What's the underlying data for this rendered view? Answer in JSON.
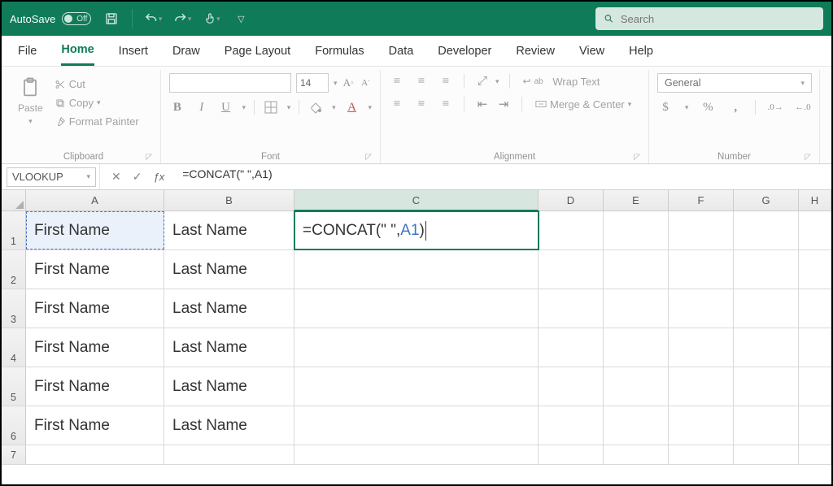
{
  "titlebar": {
    "autosave_label": "AutoSave",
    "autosave_state": "Off"
  },
  "search": {
    "placeholder": "Search"
  },
  "tabs": [
    "File",
    "Home",
    "Insert",
    "Draw",
    "Page Layout",
    "Formulas",
    "Data",
    "Developer",
    "Review",
    "View",
    "Help"
  ],
  "active_tab": "Home",
  "ribbon": {
    "clipboard": {
      "paste": "Paste",
      "cut": "Cut",
      "copy": "Copy",
      "format_painter": "Format Painter",
      "group_label": "Clipboard"
    },
    "font": {
      "size": "14",
      "group_label": "Font"
    },
    "alignment": {
      "wrap": "Wrap Text",
      "merge": "Merge & Center",
      "group_label": "Alignment"
    },
    "number": {
      "format": "General",
      "group_label": "Number"
    }
  },
  "formula_bar": {
    "name_box": "VLOOKUP",
    "formula": "=CONCAT(\"       \",A1)"
  },
  "grid": {
    "columns": [
      "A",
      "B",
      "C",
      "D",
      "E",
      "F",
      "G",
      "H"
    ],
    "selected_col": "C",
    "rows": [
      {
        "n": 1,
        "A": "First Name",
        "B": "Last Name",
        "C_edit": {
          "pre": "=CONCAT(\"       \",",
          "ref": "A1",
          "post": ")"
        },
        "selected_ref": "A"
      },
      {
        "n": 2,
        "A": "First Name",
        "B": "Last Name"
      },
      {
        "n": 3,
        "A": "First Name",
        "B": "Last Name"
      },
      {
        "n": 4,
        "A": "First Name",
        "B": "Last Name"
      },
      {
        "n": 5,
        "A": "First Name",
        "B": "Last Name"
      },
      {
        "n": 6,
        "A": "First Name",
        "B": "Last Name"
      },
      {
        "n": 7
      }
    ]
  }
}
